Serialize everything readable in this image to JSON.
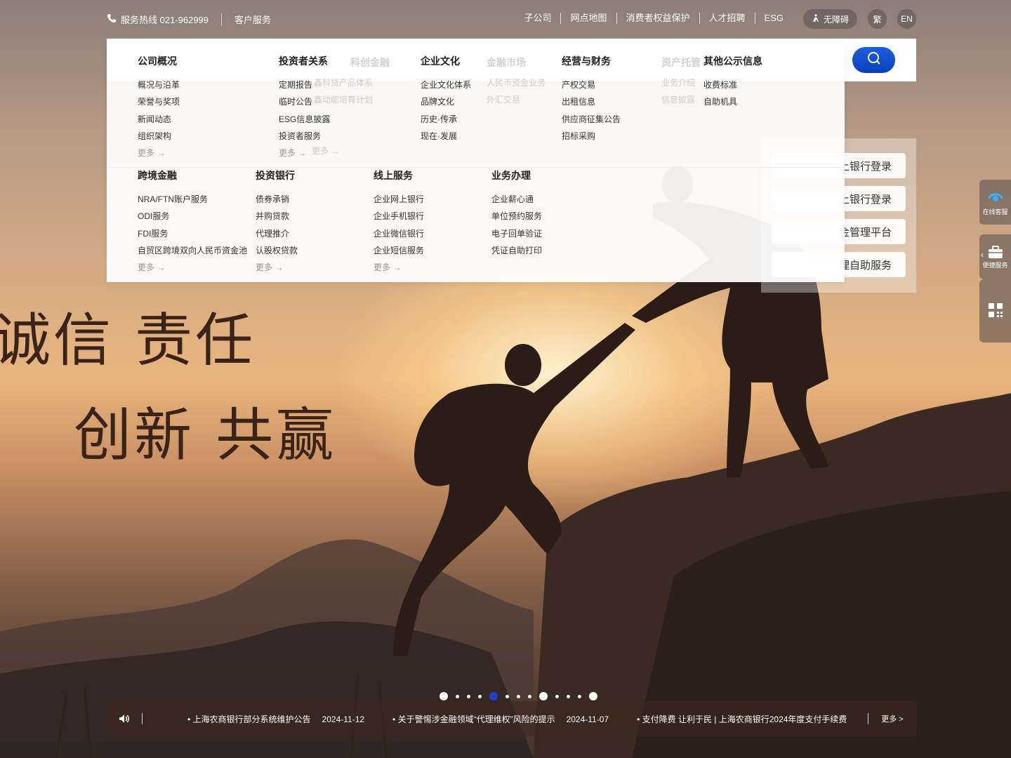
{
  "topbar": {
    "hotline": "服务热线 021-962999",
    "customer_service": "客户服务",
    "links": [
      "子公司",
      "网点地图",
      "消费者权益保护",
      "人才招聘",
      "ESG"
    ],
    "accessibility": "无障碍",
    "traditional": "繁",
    "english": "EN"
  },
  "menu": {
    "columns_top": [
      {
        "title": "公司概况",
        "items": [
          "概况与沿革",
          "荣誉与奖项",
          "新闻动态",
          "组织架构"
        ],
        "more": "更多 →"
      },
      {
        "title": "投资者关系",
        "items": [
          "定期报告",
          "临时公告",
          "ESG信息披露",
          "投资者服务"
        ],
        "more": "更多 →"
      },
      {
        "title": "企业文化",
        "items": [
          "企业文化体系",
          "品牌文化",
          "历史·传承",
          "现在·发展"
        ],
        "more": ""
      },
      {
        "title": "经营与财务",
        "items": [
          "产权交易",
          "出租信息",
          "供应商征集公告",
          "招标采购"
        ],
        "more": ""
      },
      {
        "title": "其他公示信息",
        "items": [
          "收费标准",
          "自助机具"
        ],
        "more": ""
      }
    ],
    "columns_bottom": [
      {
        "title": "跨境金融",
        "items": [
          "NRA/FTN账户服务",
          "ODI服务",
          "FDI服务",
          "自贸区跨境双向人民币资金池"
        ],
        "more": "更多 →"
      },
      {
        "title": "投资银行",
        "items": [
          "债券承销",
          "并购贷款",
          "代理推介",
          "认股权贷款"
        ],
        "more": "更多 →"
      },
      {
        "title": "线上服务",
        "items": [
          "企业网上银行",
          "企业手机银行",
          "企业微信银行",
          "企业短信服务"
        ],
        "more": "更多 →"
      },
      {
        "title": "业务办理",
        "items": [
          "企业薪心通",
          "单位预约服务",
          "电子回单验证",
          "凭证自助打印"
        ],
        "more": ""
      }
    ],
    "ghost": {
      "h1": "科创金融",
      "h2": "金融市场",
      "h3": "资产托管",
      "g1": "鑫科贷产品体系",
      "g2": "鑫动能培育计划",
      "g3": "人民币资金业务",
      "g4": "外汇交易",
      "g5": "业务介绍",
      "g6": "信息披露",
      "more": "更多 →"
    }
  },
  "login": {
    "buttons": [
      "个人网上银行登录",
      "企业网上银行登录",
      "企业现金管理平台",
      "现金管理自助服务"
    ],
    "visible_text": [
      "上银行登录",
      "上银行登录",
      "金管理平台",
      "理自助服务"
    ]
  },
  "side": {
    "online": "在线客服",
    "quick": "便捷服务"
  },
  "hero": {
    "line1": "诚信 责任",
    "line2": "创新 共赢"
  },
  "carousel": {
    "count": 13,
    "active_index": 4
  },
  "news": {
    "items": [
      {
        "title": "• 上海农商银行部分系统维护公告",
        "date": "2024-11-12"
      },
      {
        "title": "• 关于警惕涉金融领域“代理维权”风险的提示",
        "date": "2024-11-07"
      },
      {
        "title": "• 支付降费 让利于民 | 上海农商银行2024年度支付手续费",
        "date": ""
      }
    ],
    "more": "更多 >"
  },
  "colors": {
    "accent_blue": "#1f3fd1",
    "hero_text": "#3a2318"
  }
}
